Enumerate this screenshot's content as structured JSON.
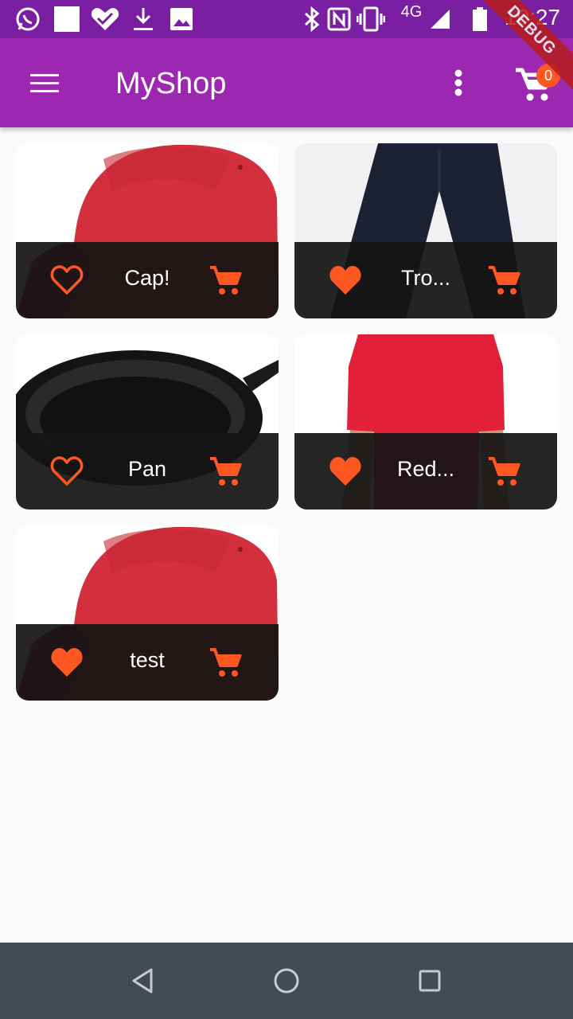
{
  "status_bar": {
    "time": "10:27",
    "network": "4G",
    "icons": [
      "whatsapp-icon",
      "square-icon",
      "health-heart-icon",
      "download-icon",
      "image-icon",
      "bluetooth-icon",
      "nfc-icon",
      "vibrate-icon",
      "signal-icon",
      "battery-icon"
    ]
  },
  "app_bar": {
    "title": "MyShop",
    "cart_count": "0",
    "debug_banner": "DEBUG"
  },
  "colors": {
    "primary": "#9c27b0",
    "primary_dark": "#7b1fa2",
    "accent": "#ff5722",
    "tile_footer": "#141414",
    "background": "#fafafa",
    "nav_bar": "#424a52"
  },
  "products": [
    {
      "title": "Cap!",
      "favorite": false,
      "image": "red-cap"
    },
    {
      "title": "Tro...",
      "favorite": true,
      "image": "trousers"
    },
    {
      "title": "Pan",
      "favorite": false,
      "image": "pan"
    },
    {
      "title": "Red...",
      "favorite": true,
      "image": "red-shirt"
    },
    {
      "title": "test",
      "favorite": true,
      "image": "red-cap"
    }
  ],
  "nav": [
    "back-icon",
    "home-icon",
    "recents-icon"
  ]
}
